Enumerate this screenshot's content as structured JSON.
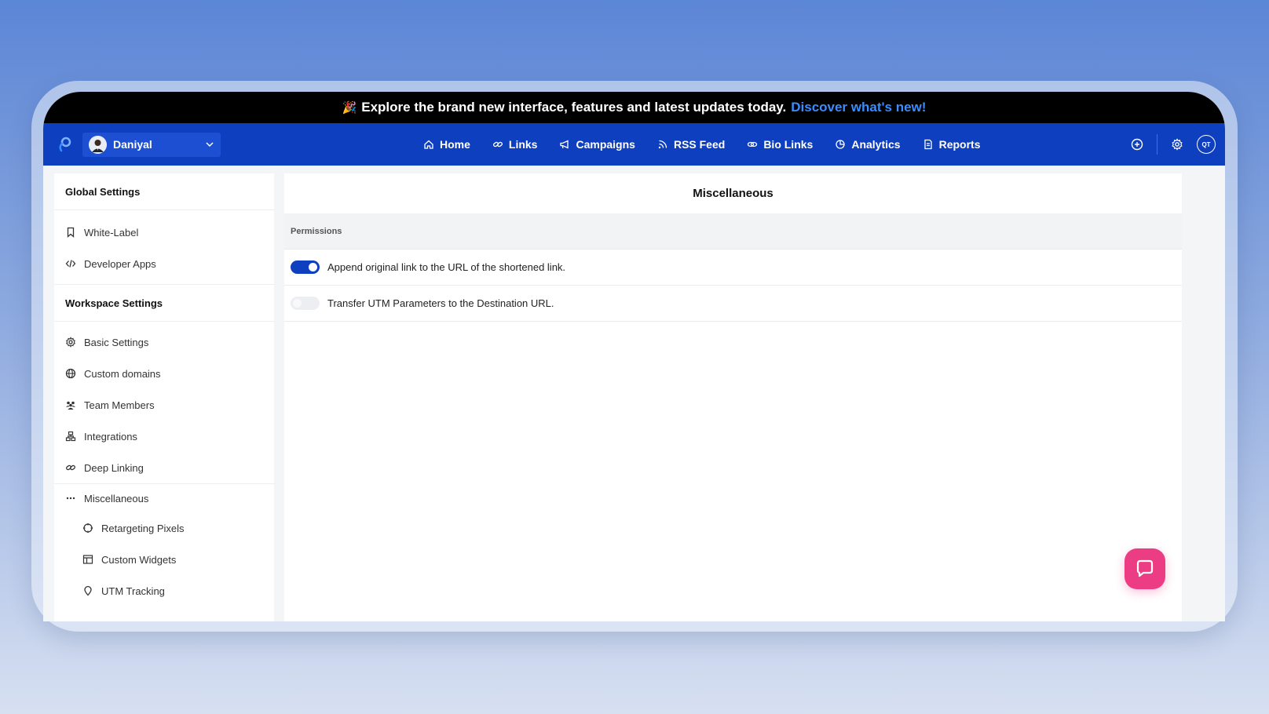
{
  "announcement": {
    "emoji": "🎉",
    "text": "Explore the brand new interface, features and latest updates today.",
    "link": "Discover what's new!"
  },
  "topnav": {
    "workspace_name": "Daniyal",
    "items": [
      {
        "label": "Home",
        "icon": "home-icon"
      },
      {
        "label": "Links",
        "icon": "link-icon"
      },
      {
        "label": "Campaigns",
        "icon": "megaphone-icon"
      },
      {
        "label": "RSS Feed",
        "icon": "rss-icon"
      },
      {
        "label": "Bio Links",
        "icon": "bio-links-icon"
      },
      {
        "label": "Analytics",
        "icon": "analytics-icon"
      },
      {
        "label": "Reports",
        "icon": "report-icon"
      }
    ],
    "user_initials": "QT"
  },
  "sidebar": {
    "global_title": "Global Settings",
    "global_items": [
      {
        "label": "White-Label",
        "icon": "bookmark-icon"
      },
      {
        "label": "Developer Apps",
        "icon": "code-icon"
      }
    ],
    "workspace_title": "Workspace Settings",
    "workspace_items": [
      {
        "label": "Basic Settings",
        "icon": "gear-icon"
      },
      {
        "label": "Custom domains",
        "icon": "globe-icon"
      },
      {
        "label": "Team Members",
        "icon": "team-icon"
      },
      {
        "label": "Integrations",
        "icon": "integrations-icon"
      },
      {
        "label": "Deep Linking",
        "icon": "link-icon"
      }
    ],
    "misc_label": "Miscellaneous",
    "misc_items": [
      {
        "label": "Retargeting Pixels",
        "icon": "crosshair-icon"
      },
      {
        "label": "Custom Widgets",
        "icon": "widget-icon"
      },
      {
        "label": "UTM Tracking",
        "icon": "location-pin-icon"
      }
    ]
  },
  "main": {
    "title": "Miscellaneous",
    "section": "Permissions",
    "permissions": [
      {
        "label": "Append original link to the URL of the shortened link.",
        "enabled": true
      },
      {
        "label": "Transfer UTM Parameters to the Destination URL.",
        "enabled": false
      }
    ]
  },
  "colors": {
    "nav_bg": "#0e3fbf",
    "accent": "#0e3fbf",
    "chat_button": "#ec3c83",
    "link": "#3b8cff"
  }
}
